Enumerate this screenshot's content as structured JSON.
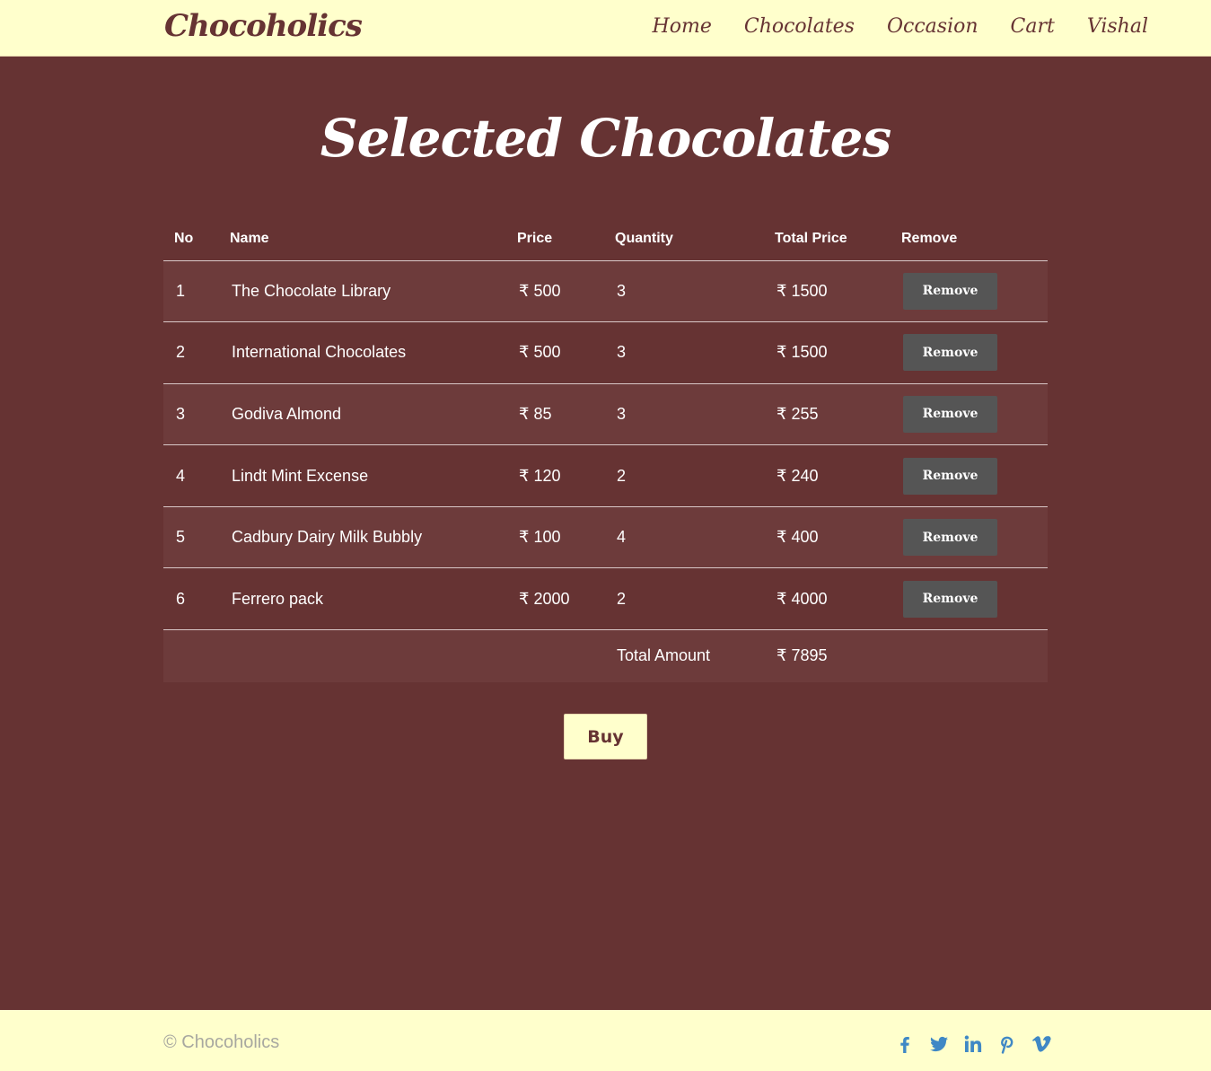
{
  "nav": {
    "brand": "Chocoholics",
    "links": [
      "Home",
      "Chocolates",
      "Occasion",
      "Cart",
      "Vishal"
    ]
  },
  "page": {
    "title": "Selected Chocolates"
  },
  "table": {
    "headers": [
      "No",
      "Name",
      "Price",
      "Quantity",
      "Total Price",
      "Remove"
    ],
    "rows": [
      {
        "no": "1",
        "name": "The Chocolate Library",
        "price": "₹ 500",
        "qty": "3",
        "total": "₹ 1500",
        "action": "Remove"
      },
      {
        "no": "2",
        "name": "International Chocolates",
        "price": "₹ 500",
        "qty": "3",
        "total": "₹ 1500",
        "action": "Remove"
      },
      {
        "no": "3",
        "name": "Godiva Almond",
        "price": "₹ 85",
        "qty": "3",
        "total": "₹ 255",
        "action": "Remove"
      },
      {
        "no": "4",
        "name": "Lindt Mint Excense",
        "price": "₹ 120",
        "qty": "2",
        "total": "₹ 240",
        "action": "Remove"
      },
      {
        "no": "5",
        "name": "Cadbury Dairy Milk Bubbly",
        "price": "₹ 100",
        "qty": "4",
        "total": "₹ 400",
        "action": "Remove"
      },
      {
        "no": "6",
        "name": "Ferrero pack",
        "price": "₹ 2000",
        "qty": "2",
        "total": "₹ 4000",
        "action": "Remove"
      }
    ],
    "total_label": "Total Amount",
    "total_value": "₹ 7895"
  },
  "buy_label": "Buy",
  "footer": {
    "copyright": "© Chocoholics",
    "social_icons": [
      "facebook-icon",
      "twitter-icon",
      "linkedin-icon",
      "pinterest-icon",
      "vimeo-icon"
    ]
  },
  "colors": {
    "background": "#663333",
    "cream": "#ffffcc",
    "button_gray": "#555555",
    "social_blue": "#3f88c5"
  }
}
